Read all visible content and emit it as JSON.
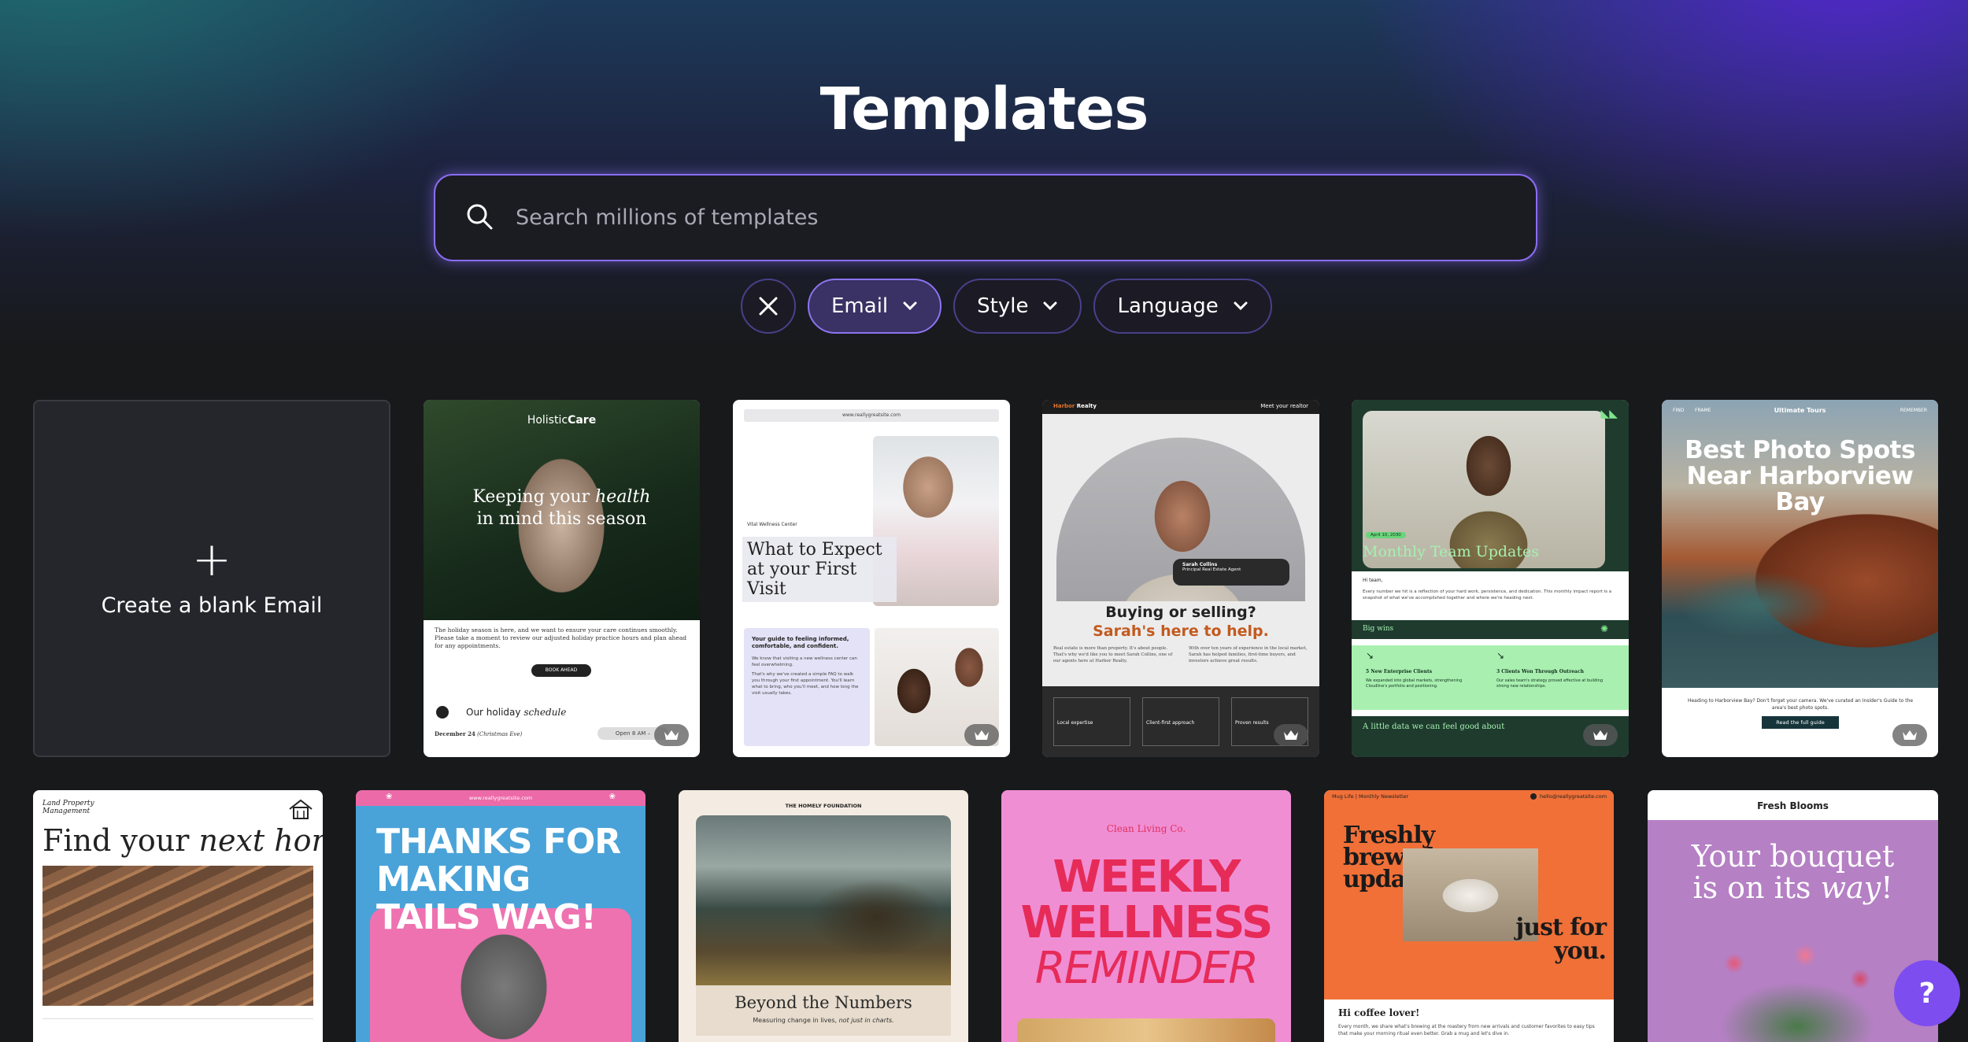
{
  "page": {
    "title": "Templates"
  },
  "search": {
    "placeholder": "Search millions of templates"
  },
  "filters": [
    {
      "label": "Email",
      "active": true
    },
    {
      "label": "Style",
      "active": false
    },
    {
      "label": "Language",
      "active": false
    }
  ],
  "blank": {
    "label": "Create a blank Email"
  },
  "cards": {
    "holistic": {
      "brand_a": "Holistic",
      "brand_b": "Care",
      "headline_a": "Keeping your ",
      "headline_em": "health",
      "headline_b": "in mind this season",
      "body": "The holiday season is here, and we want to ensure your care continues smoothly. Please take a moment to review our adjusted holiday practice hours and plan ahead for any appointments.",
      "button": "BOOK AHEAD",
      "schedule_a": "Our holiday ",
      "schedule_em": "schedule",
      "date": "December 24",
      "date_note": "(Christmas Eve)",
      "hours": "Open 8 AM –"
    },
    "wellness": {
      "url": "www.reallygreatsite.com",
      "org": "Vital Wellness Center",
      "headline": "What to Expect at your First Visit",
      "sub": "Your guide to feeling informed, comfortable, and confident.",
      "p1": "We know that visiting a new wellness center can feel overwhelming.",
      "p2": "That's why we've created a simple FAQ to walk you through your first appointment. You'll learn what to bring, who you'll meet, and how long the visit usually takes."
    },
    "realty": {
      "brand_a": "Harbor",
      "brand_b": " Realty",
      "meet": "Meet your realtor",
      "name": "Sarah Collins",
      "role": "Principal Real Estate Agent",
      "h1": "Buying or selling?",
      "h2": "Sarah's here to help.",
      "p1": "Real estate is more than property. It's about people. That's why we'd like you to meet Sarah Collins, one of our agents here at Harbor Realty.",
      "p2": "With over ten years of experience in the local market, Sarah has helped families, first-time buyers, and investors achieve great results.",
      "f1": "Local expertise",
      "f2": "Client-first approach",
      "f3": "Proven results"
    },
    "team": {
      "date": "April 10, 2030",
      "headline": "Monthly Team Updates",
      "greet": "Hi team,",
      "body": "Every number we hit is a reflection of your hard work, persistence, and dedication. This monthly impact report is a snapshot of what we've accomplished together and where we're heading next.",
      "band": "Big wins",
      "w1": "5 New Enterprise Clients",
      "w1d": "We expanded into global markets, strengthening Cloudline's portfolio and positioning.",
      "w2": "3 Clients Won Through Outreach",
      "w2d": "Our sales team's strategy proved effective at building strong new relationships.",
      "footer": "A little data we can feel good about"
    },
    "photo": {
      "nav1": "FIND",
      "nav2": "FRAME",
      "brand": "Ultimate Tours",
      "nav3": "REMEMBER",
      "headline": "Best Photo Spots Near Harborview Bay",
      "body": "Heading to Harborview Bay? Don't forget your camera. We've curated an Insider's Guide to the area's best photo spots.",
      "button": "Read the full guide"
    },
    "land": {
      "brand_a": "Land Property",
      "brand_b": "Management",
      "headline_a": "Find your ",
      "headline_em": "next home"
    },
    "tails": {
      "url": "www.reallygreatsite.com",
      "headline": "THANKS FOR MAKING TAILS WAG!"
    },
    "numbers": {
      "org": "THE HOMELY FOUNDATION",
      "headline": "Beyond the Numbers",
      "sub_a": "Measuring change in lives, ",
      "sub_em": "not just in charts."
    },
    "weekly": {
      "brand": "Clean Living Co.",
      "l1": "WEEKLY",
      "l2": "WELLNESS",
      "l3": "REMINDER"
    },
    "coffee": {
      "brand": "Mug Life",
      "sep": "|",
      "label": "Monthly Newsletter",
      "email": "hello@reallygreatsite.com",
      "h1": "Freshly brewed updates,",
      "h2": "just for you.",
      "greet": "Hi coffee lover!",
      "body": "Every month, we share what's brewing at the roastery from new arrivals and customer favorites to easy tips that make your morning ritual even better. Grab a mug and let's dive in."
    },
    "blooms": {
      "brand": "Fresh Blooms",
      "headline_a": "Your bouquet is on its ",
      "headline_em": "way",
      "headline_b": "!"
    }
  },
  "help": {
    "label": "?"
  },
  "colors": {
    "accent": "#8b6cf5",
    "help": "#7d4df0"
  }
}
